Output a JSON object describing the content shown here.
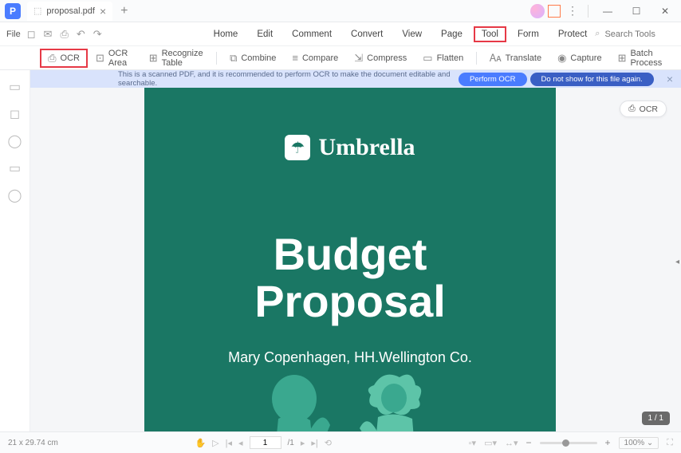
{
  "window": {
    "app_initial": "P",
    "tab_title": "proposal.pdf",
    "tab_icon": "⬚",
    "close": "×",
    "add": "+",
    "minimize": "—",
    "maximize": "☐",
    "close_win": "✕"
  },
  "menubar": {
    "file": "File",
    "items": [
      "Home",
      "Edit",
      "Comment",
      "Convert",
      "View",
      "Page",
      "Tool",
      "Form",
      "Protect"
    ],
    "highlighted_index": 6,
    "search_placeholder": "Search Tools"
  },
  "toolbar": {
    "items": [
      {
        "icon": "⎙",
        "label": "OCR",
        "highlighted": true
      },
      {
        "icon": "⊡",
        "label": "OCR Area"
      },
      {
        "icon": "⊞",
        "label": "Recognize Table"
      },
      {
        "icon": "⧉",
        "label": "Combine"
      },
      {
        "icon": "≡",
        "label": "Compare"
      },
      {
        "icon": "⇲",
        "label": "Compress"
      },
      {
        "icon": "▭",
        "label": "Flatten"
      },
      {
        "icon": "🗛",
        "label": "Translate"
      },
      {
        "icon": "◉",
        "label": "Capture"
      },
      {
        "icon": "⊞",
        "label": "Batch Process"
      }
    ]
  },
  "notice": {
    "text": "This is a scanned PDF, and it is recommended to perform OCR to make the document editable and searchable.",
    "btn_primary": "Perform OCR",
    "btn_secondary": "Do not show for this file again.",
    "close": "×"
  },
  "document": {
    "brand": "Umbrella",
    "logo_glyph": "☂",
    "title_line1": "Budget",
    "title_line2": "Proposal",
    "author": "Mary Copenhagen, HH.Wellington Co."
  },
  "ocr_pill": {
    "icon": "⎙",
    "label": "OCR"
  },
  "page_badge": "1 / 1",
  "status": {
    "dimensions": "21 x 29.74 cm",
    "page_current": "1",
    "page_total": "/1",
    "zoom": "100%",
    "dropdown": "⌄"
  }
}
